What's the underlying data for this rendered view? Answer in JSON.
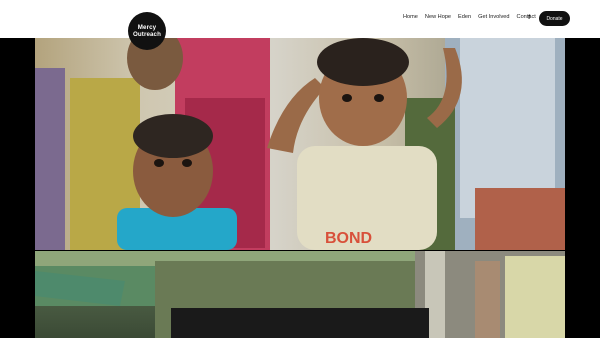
{
  "brand": {
    "line1": "Mercy",
    "line2": "Outreach"
  },
  "nav": {
    "items": [
      {
        "label": "Home"
      },
      {
        "label": "New Hope"
      },
      {
        "label": "Eden"
      },
      {
        "label": "Get Involved"
      },
      {
        "label": "Contact"
      }
    ],
    "facebook_icon": "f",
    "donate_label": "Donate"
  },
  "hero": {
    "shirt_text": "BOND"
  }
}
